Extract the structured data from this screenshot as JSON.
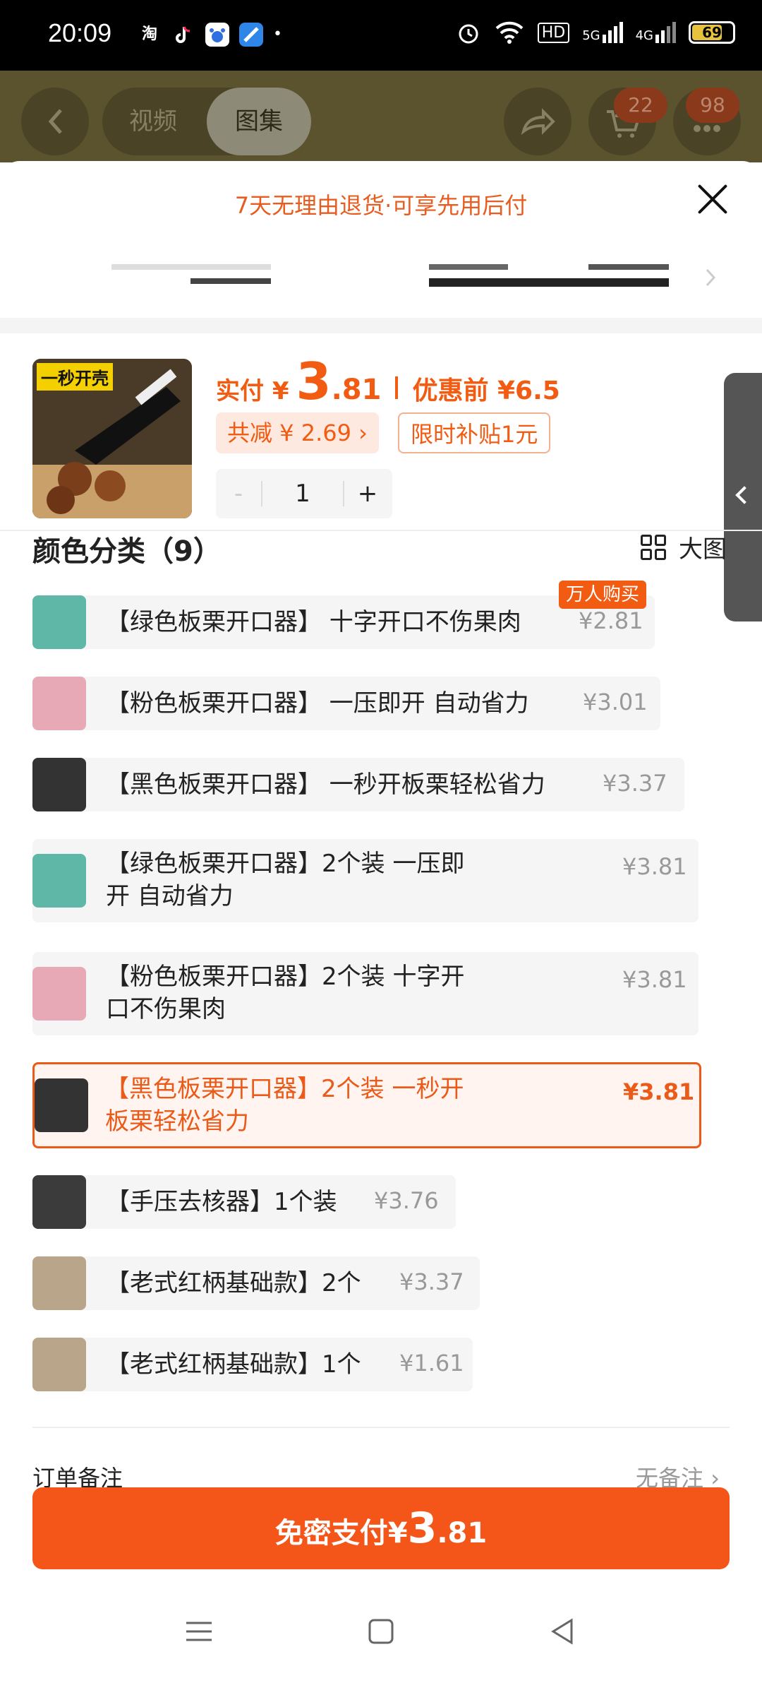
{
  "status_bar": {
    "time": "20:09",
    "app_icons": [
      "淘",
      "tiktok-icon",
      "baidu-icon",
      "app-icon",
      "•"
    ],
    "network": [
      "HD",
      "5G",
      "4G"
    ],
    "battery": "69"
  },
  "header": {
    "back_icon": "chevron-left-icon",
    "tabs": [
      "视频",
      "图集"
    ],
    "active_tab": "图集",
    "share_icon": "share-icon",
    "cart_badge": "22",
    "more_badge": "98"
  },
  "sheet": {
    "banner": "7天无理由退货·可享先用后付",
    "product": {
      "thumb_label": "一秒开壳",
      "price_label": "实付 ¥",
      "price_int": "3",
      "price_dec": ".81",
      "before_label": "优惠前 ¥6.5",
      "discount_chip": "共减 ¥ 2.69 ›",
      "subsidy_chip": "限时补贴1元",
      "qty_minus": "-",
      "qty": "1",
      "qty_plus": "+"
    },
    "section_title": "颜色分类（9）",
    "big_view": "大图",
    "options": [
      {
        "name": "【绿色板栗开口器】 十字开口不伤果肉",
        "price": "¥2.81",
        "tag": "万人购买"
      },
      {
        "name": "【粉色板栗开口器】 一压即开 自动省力",
        "price": "¥3.01"
      },
      {
        "name": "【黑色板栗开口器】 一秒开板栗轻松省力",
        "price": "¥3.37"
      },
      {
        "name": "【绿色板栗开口器】2个装 一压即开 自动省力",
        "price": "¥3.81"
      },
      {
        "name": "【粉色板栗开口器】2个装 十字开口不伤果肉",
        "price": "¥3.81"
      },
      {
        "name": "【黑色板栗开口器】2个装 一秒开板栗轻松省力",
        "price": "¥3.81",
        "selected": true
      },
      {
        "name": "【手压去核器】1个装",
        "price": "¥3.76"
      },
      {
        "name": "【老式红柄基础款】2个",
        "price": "¥3.37"
      },
      {
        "name": "【老式红柄基础款】1个",
        "price": "¥1.61"
      }
    ],
    "order_note_label": "订单备注",
    "order_note_value": "无备注 ›",
    "pay_button": {
      "prefix": "免密支付¥",
      "int": "3",
      "dec": ".81"
    }
  },
  "colors": {
    "accent": "#f4561a",
    "price": "#f25b12"
  }
}
